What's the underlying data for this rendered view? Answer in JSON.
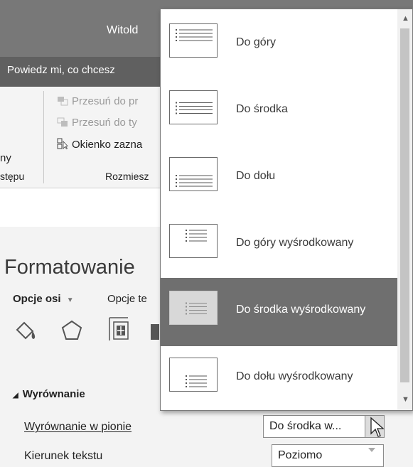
{
  "window": {
    "user_name": "Witold"
  },
  "tell_me": {
    "text": "Powiedz mi, co chcesz"
  },
  "ribbon": {
    "partial_left_1": "ny",
    "partial_left_2": "stępu",
    "bring_forward": "Przesuń do pr",
    "send_backward": "Przesuń do ty",
    "selection_pane": "Okienko zazna",
    "group_label": "Rozmiesz"
  },
  "pane": {
    "title": "Formatowanie",
    "tab_axis_options": "Opcje osi",
    "tab_text_options": "Opcje te",
    "section_alignment": "Wyrównanie",
    "vertical_alignment_label": "Wyrównanie w pionie",
    "vertical_alignment_value": "Do środka w...",
    "text_direction_label": "Kierunek tekstu",
    "text_direction_value": "Poziomo"
  },
  "dropdown": {
    "items": [
      {
        "label": "Do góry",
        "lines": "top-left",
        "selected": false
      },
      {
        "label": "Do środka",
        "lines": "middle-left",
        "selected": false
      },
      {
        "label": "Do dołu",
        "lines": "bottom-left",
        "selected": false
      },
      {
        "label": "Do góry wyśrodkowany",
        "lines": "top-center",
        "selected": false
      },
      {
        "label": "Do środka wyśrodkowany",
        "lines": "middle-center",
        "selected": true
      },
      {
        "label": "Do dołu wyśrodkowany",
        "lines": "bottom-center",
        "selected": false
      }
    ]
  },
  "colors": {
    "selected_bg": "#6f6f6f",
    "titlebar_bg": "#787878",
    "tellbar_bg": "#606060"
  }
}
